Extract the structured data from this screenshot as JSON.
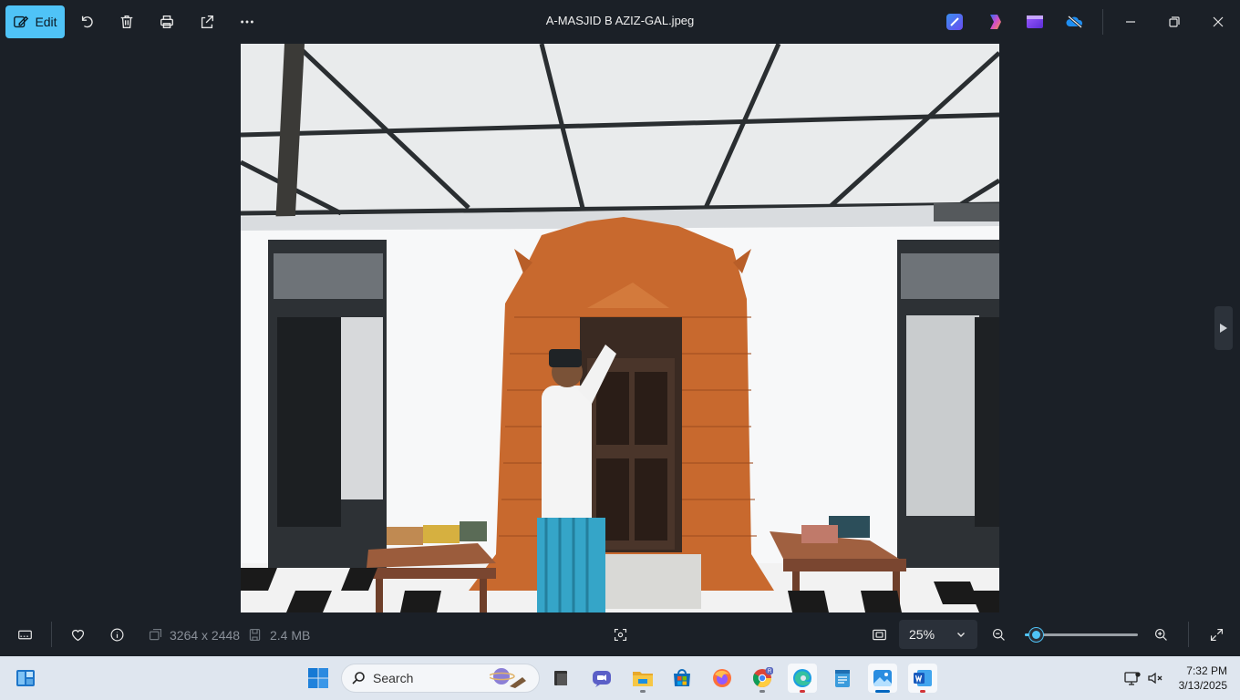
{
  "toolbar": {
    "edit_label": "Edit",
    "title": "A-MASJID B AZIZ-GAL.jpeg"
  },
  "bottom": {
    "dimensions": "3264 x 2448",
    "file_size": "2.4 MB",
    "zoom_value": "25%",
    "zoom_level": 0.05
  },
  "taskbar": {
    "search_placeholder": "Search",
    "time": "7:32 PM",
    "date": "3/13/2025"
  },
  "colors": {
    "accent": "#4fc3f7",
    "background": "#1b2027",
    "taskbar": "#dfe6ef"
  },
  "icons": {
    "top": [
      "edit-icon",
      "rotate-icon",
      "delete-icon",
      "print-icon",
      "share-icon",
      "more-icon",
      "designer-icon",
      "copilot-icon",
      "clipchamp-icon",
      "onedrive-icon",
      "minimize-icon",
      "restore-icon",
      "close-icon"
    ],
    "bottom": [
      "filmstrip-icon",
      "favorite-icon",
      "info-icon",
      "dimensions-icon",
      "filesize-icon",
      "focus-icon",
      "fit-icon",
      "zoom-out-icon",
      "zoom-in-icon",
      "fullscreen-icon"
    ],
    "taskbar": [
      "widgets-icon",
      "start-icon",
      "search-icon",
      "task-view-icon",
      "chat-icon",
      "file-explorer-icon",
      "store-icon",
      "firefox-icon",
      "chrome-icon",
      "edge-icon",
      "notepad-icon",
      "photos-icon",
      "word-icon",
      "network-icon",
      "volume-icon"
    ]
  }
}
